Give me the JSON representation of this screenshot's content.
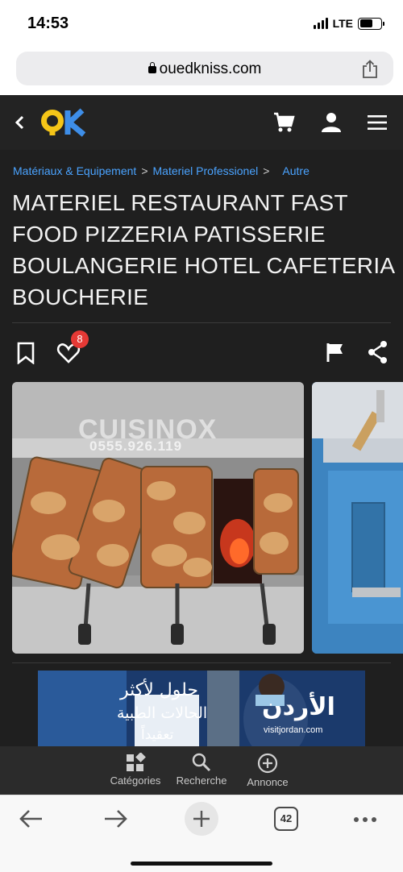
{
  "status_bar": {
    "time": "14:53",
    "network": "LTE"
  },
  "browser": {
    "url": "ouedkniss.com",
    "open_tabs": "42"
  },
  "header": {
    "logo": "OK"
  },
  "breadcrumb": [
    "Matériaux & Equipement",
    "Materiel Professionel",
    "Autre"
  ],
  "listing": {
    "title": "MATERIEL RESTAURANT FAST FOOD PIZZERIA PATISSERIE BOULANGERIE HOTEL CAFETERIA BOUCHERIE",
    "likes_count": "8",
    "photo_watermark": "CUISINOX",
    "photo_phone": "0555.926.119"
  },
  "ad": {
    "line1": "حلول لأكثر",
    "line2": "الحالات الطبية",
    "line3": "تعقيداً",
    "brand": "الأردن",
    "url": "visitjordan.com"
  },
  "bottom_nav": [
    {
      "label": "Catégories",
      "icon": "categories-icon"
    },
    {
      "label": "Recherche",
      "icon": "search-icon"
    },
    {
      "label": "Annonce",
      "icon": "add-circle-icon"
    }
  ],
  "colors": {
    "header_bg": "#232323",
    "accent": "#f5c518",
    "link": "#4aa3ff",
    "badge": "#e53935"
  }
}
